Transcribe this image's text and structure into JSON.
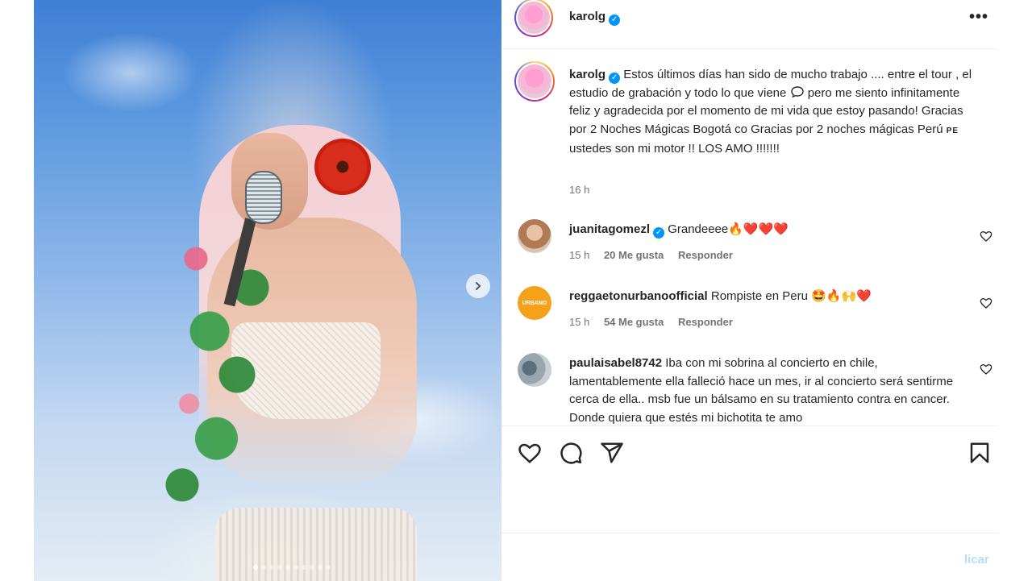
{
  "post": {
    "username": "karolg",
    "caption_user": "karolg",
    "caption_text_1": "Estos últimos días han sido de mucho trabajo .... entre el tour , el estudio de grabación y todo lo que viene",
    "caption_text_2": "pero me siento infinitamente feliz y agradecida por el momento de mi vida que estoy pasando! Gracias por 2 Noches Mágicas Bogotá co Gracias por 2 noches mágicas Perú",
    "caption_flag": "PE",
    "caption_text_3": "ustedes son mi motor !! LOS AMO !!!!!!!",
    "caption_time": "16 h"
  },
  "comments": [
    {
      "user": "juanitagomezl",
      "verified": true,
      "text": "Grandeeee🔥❤️❤️❤️",
      "time": "15 h",
      "likes": "20 Me gusta",
      "reply": "Responder"
    },
    {
      "user": "reggaetonurbanoofficial",
      "verified": false,
      "avatar_text": "URBANO",
      "text": "Rompiste en Peru 🤩🔥🙌❤️",
      "time": "15 h",
      "likes": "54 Me gusta",
      "reply": "Responder"
    },
    {
      "user": "paulaisabel8742",
      "verified": false,
      "text": "Iba con mi sobrina al concierto en chile, lamentablemente ella falleció hace un mes, ir al concierto será sentirme cerca de ella.. msb fue un bálsamo en su tratamiento contra en cancer. Donde quiera que estés mi bichotita te amo"
    }
  ],
  "carousel": {
    "total_slides": 10,
    "active_index": 0
  },
  "publish_partial": "licar",
  "colors": {
    "verified": "#0095f6",
    "publish": "#b2dffc",
    "muted": "#737373"
  },
  "icons": [
    "more-options-icon",
    "verified-icon",
    "chat-bubble-icon",
    "heart-icon",
    "comment-icon",
    "share-icon",
    "bookmark-icon",
    "next-arrow-icon"
  ]
}
